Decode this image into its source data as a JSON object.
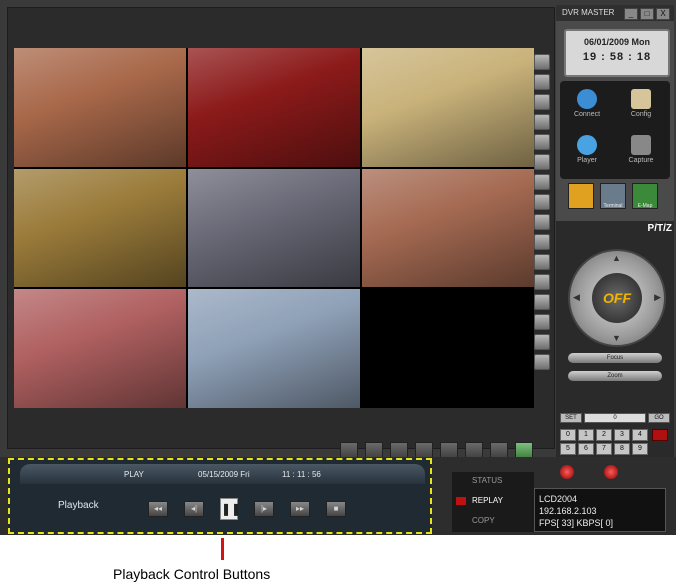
{
  "window": {
    "title": "DVR MASTER",
    "controls": [
      "_",
      "□",
      "X"
    ]
  },
  "clock": {
    "date": "06/01/2009 Mon",
    "time": "19 : 58 : 18"
  },
  "menu_icons": [
    {
      "label": "Connect",
      "icon": "connect-icon",
      "color": "#3b8ed3"
    },
    {
      "label": "Config",
      "icon": "camera-icon",
      "color": "#d6c49a"
    },
    {
      "label": "Player",
      "icon": "player-icon",
      "color": "#49a3e2"
    },
    {
      "label": "Capture",
      "icon": "capture-icon",
      "color": "#888888"
    }
  ],
  "mode_tabs": [
    "Terminal",
    "E-Map"
  ],
  "ptz": {
    "tab_label": "P/T/Z",
    "center_label": "OFF",
    "focus_label": "Focus",
    "zoom_label": "Zoom"
  },
  "preset": {
    "set_label": "SET",
    "value": "0",
    "go_label": "GO"
  },
  "keypad": [
    "0",
    "1",
    "2",
    "3",
    "4",
    "5",
    "6",
    "7",
    "8",
    "9"
  ],
  "playback": {
    "mode": "PLAY",
    "date": "05/15/2009 Fri",
    "time": "11 : 11 : 56",
    "label": "Playback",
    "buttons": [
      {
        "name": "fast-rewind",
        "glyph": "◂◂"
      },
      {
        "name": "step-back",
        "glyph": "◂|"
      },
      {
        "name": "pause",
        "glyph": "❚❚"
      },
      {
        "name": "step-forward",
        "glyph": "|▸"
      },
      {
        "name": "fast-forward",
        "glyph": "▸▸"
      },
      {
        "name": "stop",
        "glyph": "■"
      }
    ]
  },
  "status_menu": {
    "items": [
      "STATUS",
      "REPLAY",
      "COPY"
    ],
    "selected": "REPLAY"
  },
  "network": {
    "line1": "LCD2004",
    "line2": "192.168.2.103",
    "line3": "FPS[ 33]  KBPS[  0]"
  },
  "annotation": {
    "text": "Playback Control Buttons"
  },
  "cameras": [
    {
      "id": 1,
      "tone": "#a8684a"
    },
    {
      "id": 2,
      "tone": "#8c1a1a"
    },
    {
      "id": 3,
      "tone": "#c9b27a"
    },
    {
      "id": 4,
      "tone": "#9a7b3a"
    },
    {
      "id": 5,
      "tone": "#6a6a78"
    },
    {
      "id": 6,
      "tone": "#a56a52"
    },
    {
      "id": 7,
      "tone": "#b06060"
    },
    {
      "id": 8,
      "tone": "#8fa1b8"
    },
    {
      "id": 9,
      "tone": "#000000"
    }
  ]
}
